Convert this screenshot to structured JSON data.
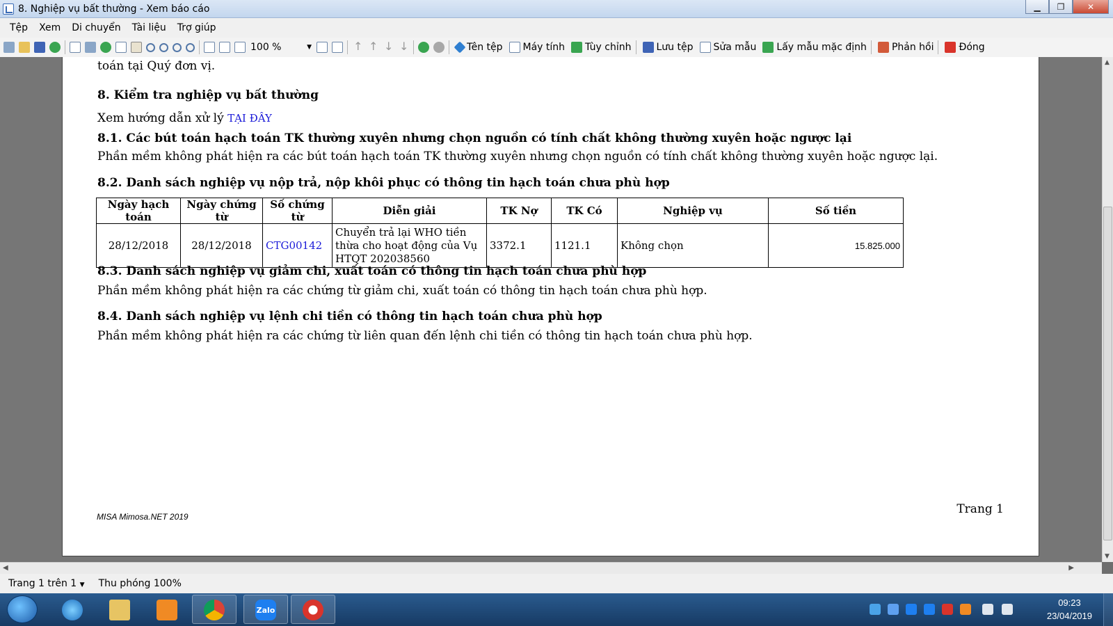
{
  "window": {
    "title": "8. Nghiệp vụ bất thường - Xem báo cáo"
  },
  "menu": [
    "Tệp",
    "Xem",
    "Di chuyển",
    "Tài liệu",
    "Trợ giúp"
  ],
  "toolbar": {
    "zoom": "100 %",
    "file_name": "Tên tệp",
    "calculator": "Máy tính",
    "customize": "Tùy chỉnh",
    "save_file": "Lưu tệp",
    "edit_template": "Sửa mẫu",
    "default_template": "Lấy mẫu mặc định",
    "feedback": "Phản hồi",
    "close": "Đóng"
  },
  "report": {
    "top_fragment": "toán tại Quý đơn vị.",
    "sec8_title": "8. Kiểm tra nghiệp vụ bất thường",
    "guide_text": "Xem hướng dẫn xử lý",
    "guide_link": "TẠI ĐÂY",
    "sec81_title": "8.1. Các bút toán hạch toán TK thường xuyên nhưng chọn nguồn có tính chất không thường xuyên hoặc ngược lại",
    "sec81_text": "Phần mềm không phát hiện ra các bút toán hạch toán TK thường xuyên nhưng chọn nguồn có tính chất không thường xuyên hoặc ngược lại.",
    "sec82_title": "8.2. Danh sách nghiệp vụ nộp trả, nộp khôi phục có thông tin hạch toán chưa phù hợp",
    "table": {
      "headers": [
        "Ngày hạch toán",
        "Ngày chứng từ",
        "Số chứng từ",
        "Diễn giải",
        "TK Nợ",
        "TK Có",
        "Nghiệp vụ",
        "Số tiền"
      ],
      "rows": [
        {
          "posting_date": "28/12/2018",
          "doc_date": "28/12/2018",
          "doc_no": "CTG00142",
          "description": "Chuyển trả lại WHO tiền thừa cho hoạt động của  Vụ HTQT 202038560",
          "debit": "3372.1",
          "credit": "1121.1",
          "operation": "Không chọn",
          "amount": "15.825.000"
        }
      ]
    },
    "sec83_title": "8.3. Danh sách nghiệp vụ giảm chi, xuất toán có thông tin hạch toán chưa phù hợp",
    "sec83_text": "Phần mềm không phát hiện ra các chứng từ giảm chi, xuất toán có thông tin hạch toán chưa phù hợp.",
    "sec84_title": "8.4. Danh sách nghiệp vụ lệnh chi tiền có thông tin hạch toán chưa phù hợp",
    "sec84_text": "Phần mềm không phát hiện ra các chứng từ liên quan đến lệnh chi tiền có thông tin hạch toán chưa phù hợp.",
    "footer_left": "MISA Mimosa.NET 2019",
    "footer_right": "Trang 1"
  },
  "status": {
    "page": "Trang 1 trên 1",
    "zoom": "Thu phóng 100%"
  },
  "taskbar": {
    "tray_labels": {
      "zalo": "Zalo"
    },
    "clock": {
      "time": "09:23",
      "date": "23/04/2019"
    }
  },
  "colors": {
    "link": "#1a1ad8",
    "taskbar": "#1f4a7a",
    "page_bg": "#ffffff"
  }
}
